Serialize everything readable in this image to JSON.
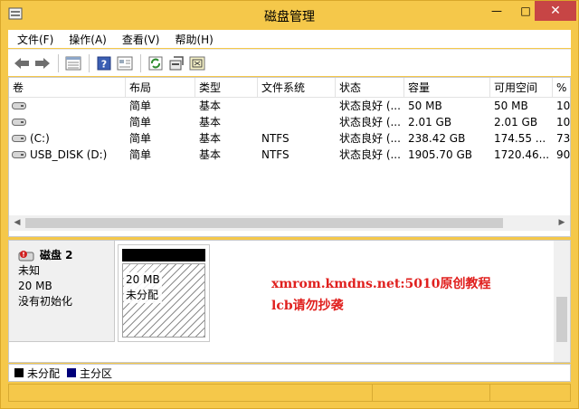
{
  "window": {
    "title": "磁盘管理",
    "minimize_label": "—",
    "maximize_label": "□",
    "close_label": "✕"
  },
  "menu": {
    "items": [
      {
        "label": "文件(F)"
      },
      {
        "label": "操作(A)"
      },
      {
        "label": "查看(V)"
      },
      {
        "label": "帮助(H)"
      }
    ]
  },
  "toolbar": {
    "icons": [
      "back-icon",
      "forward-icon",
      "volume-list-icon",
      "help-icon",
      "properties-icon",
      "refresh-icon",
      "settings-icon",
      "rescan-icon"
    ]
  },
  "volume_list": {
    "columns": [
      "卷",
      "布局",
      "类型",
      "文件系统",
      "状态",
      "容量",
      "可用空间",
      "%"
    ],
    "rows": [
      {
        "volume": "",
        "layout": "简单",
        "type": "基本",
        "fs": "",
        "status": "状态良好 (...",
        "capacity": "50 MB",
        "free": "50 MB",
        "pct": "10"
      },
      {
        "volume": "",
        "layout": "简单",
        "type": "基本",
        "fs": "",
        "status": "状态良好 (...",
        "capacity": "2.01 GB",
        "free": "2.01 GB",
        "pct": "10"
      },
      {
        "volume": "(C:)",
        "layout": "简单",
        "type": "基本",
        "fs": "NTFS",
        "status": "状态良好 (...",
        "capacity": "238.42 GB",
        "free": "174.55 ...",
        "pct": "73"
      },
      {
        "volume": "USB_DISK (D:)",
        "layout": "简单",
        "type": "基本",
        "fs": "NTFS",
        "status": "状态良好 (...",
        "capacity": "1905.70 GB",
        "free": "1720.46...",
        "pct": "90"
      }
    ]
  },
  "disk": {
    "name": "磁盘 2",
    "kind": "未知",
    "size": "20 MB",
    "state": "没有初始化",
    "partition": {
      "size": "20 MB",
      "label": "未分配"
    }
  },
  "watermark": {
    "line1": "xmrom.kmdns.net:5010原创教程",
    "line2": "lcb请勿抄袭"
  },
  "legend": {
    "items": [
      {
        "label": "未分配",
        "color": "#000000"
      },
      {
        "label": "主分区",
        "color": "#00007a"
      }
    ]
  },
  "colors": {
    "frame": "#f5c84a",
    "close": "#c74545",
    "watermark": "#e0201e"
  }
}
